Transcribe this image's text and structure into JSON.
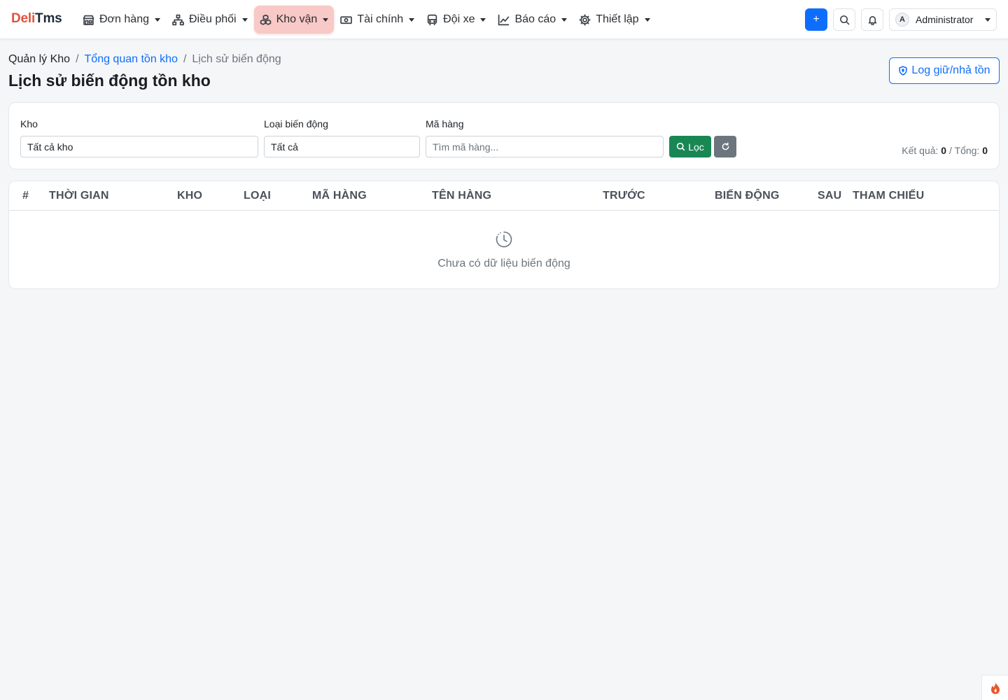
{
  "brand": {
    "part1": "Deli",
    "part2": "Tms"
  },
  "nav": {
    "items": [
      {
        "label": "Đơn hàng"
      },
      {
        "label": "Điều phối"
      },
      {
        "label": "Kho vận"
      },
      {
        "label": "Tài chính"
      },
      {
        "label": "Đội xe"
      },
      {
        "label": "Báo cáo"
      },
      {
        "label": "Thiết lập"
      }
    ],
    "active_index": 2,
    "user": {
      "initial": "A",
      "name": "Administrator"
    },
    "plus_label": "+"
  },
  "breadcrumb": {
    "root": "Quản lý Kho",
    "parent": "Tổng quan tồn kho",
    "current": "Lịch sử biến động",
    "separator": "/"
  },
  "page": {
    "title": "Lịch sử biến động tồn kho",
    "log_button": "Log giữ/nhả tồn"
  },
  "filters": {
    "warehouse": {
      "label": "Kho",
      "value": "Tất cả kho"
    },
    "movement_type": {
      "label": "Loại biến động",
      "value": "Tất cả"
    },
    "item_code": {
      "label": "Mã hàng",
      "placeholder": "Tìm mã hàng..."
    },
    "filter_button": "Lọc",
    "result_label": "Kết quả:",
    "result_count": "0",
    "total_label": "/ Tổng:",
    "total_count": "0"
  },
  "table": {
    "columns": [
      "#",
      "THỜI GIAN",
      "KHO",
      "LOẠI",
      "MÃ HÀNG",
      "TÊN HÀNG",
      "TRƯỚC",
      "BIẾN ĐỘNG",
      "SAU",
      "THAM CHIẾU"
    ],
    "rows": [],
    "empty_text": "Chưa có dữ liệu biến động"
  },
  "colors": {
    "brand_red": "#e0533f",
    "primary": "#0d6efd",
    "success": "#198754",
    "secondary": "#6c757d",
    "active_nav_bg": "#f8c9c6"
  }
}
